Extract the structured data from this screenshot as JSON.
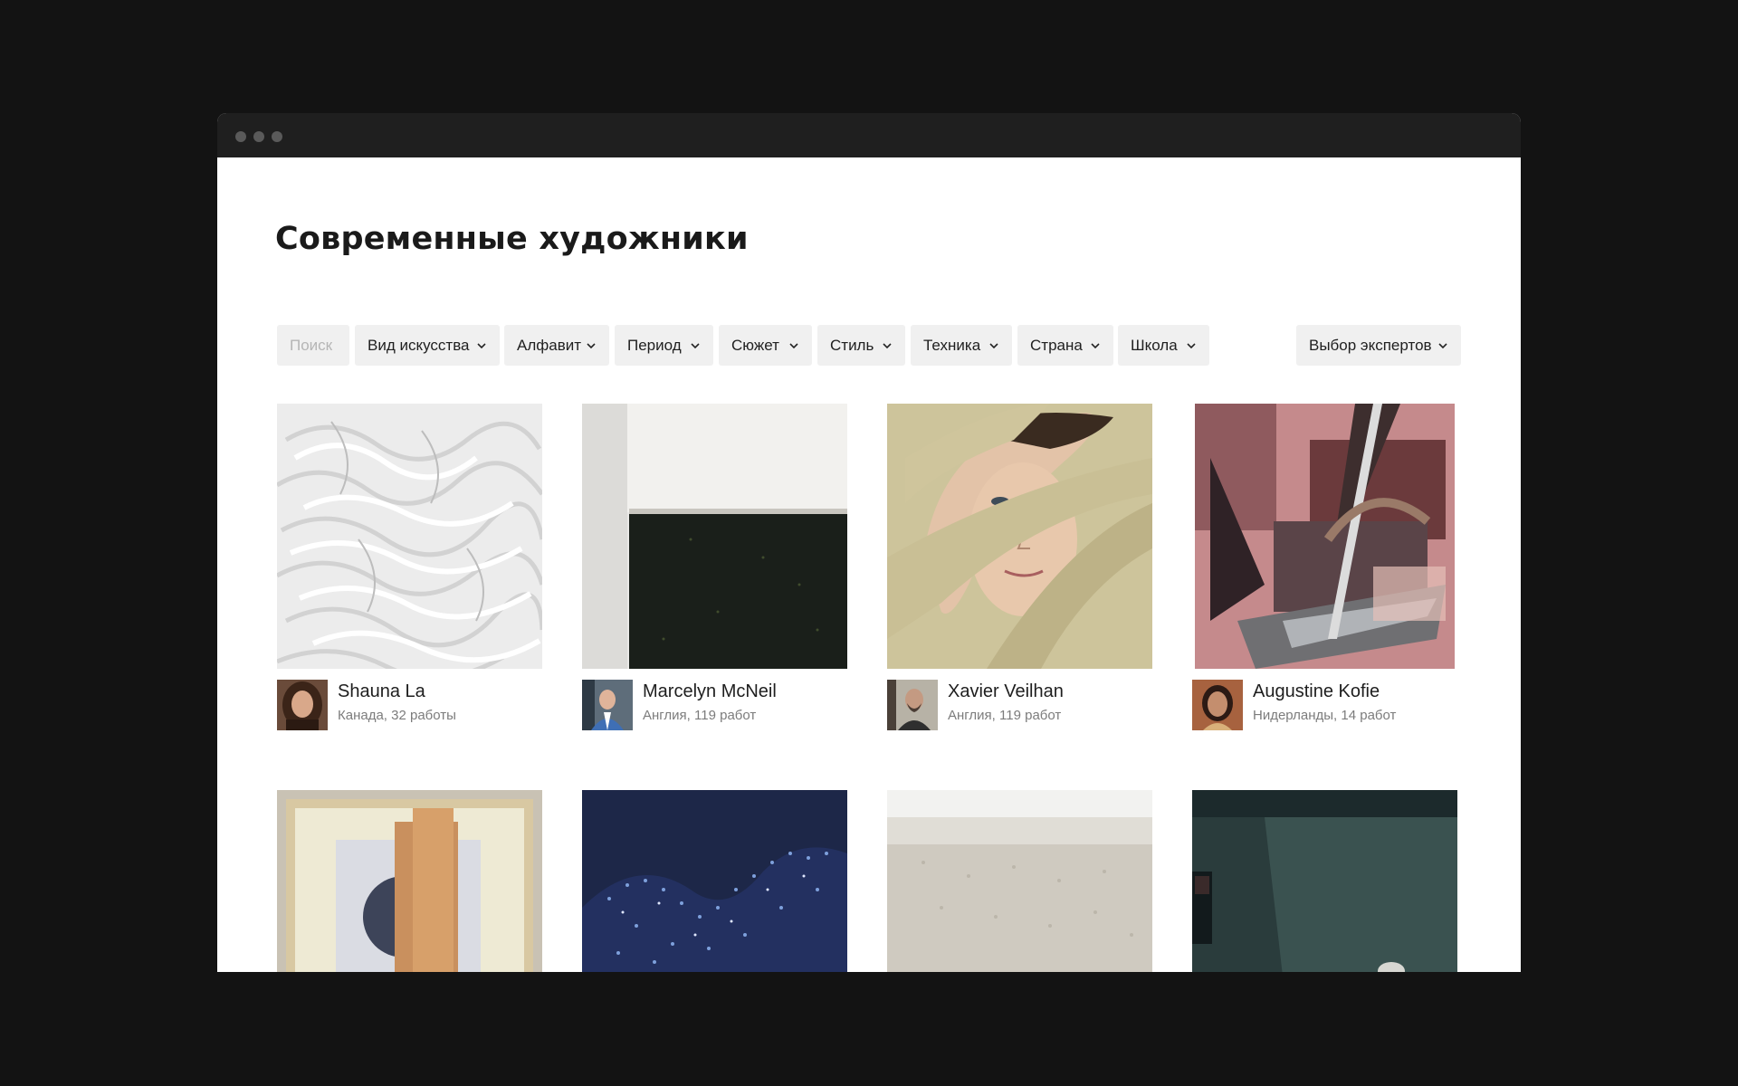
{
  "page": {
    "title": "Современные художники"
  },
  "filters": {
    "search_placeholder": "Поиск",
    "items": [
      {
        "label": "Вид искусства"
      },
      {
        "label": "Алфавит"
      },
      {
        "label": "Период"
      },
      {
        "label": "Сюжет"
      },
      {
        "label": "Стиль"
      },
      {
        "label": "Техника"
      },
      {
        "label": "Страна"
      },
      {
        "label": "Школа"
      }
    ],
    "experts": "Выбор экспертов"
  },
  "artists": [
    {
      "name": "Shauna La",
      "details": "Канада, 32 работы"
    },
    {
      "name": "Marcelyn McNeil",
      "details": "Англия, 119 работ"
    },
    {
      "name": "Xavier Veilhan",
      "details": "Англия, 119 работ"
    },
    {
      "name": "Augustine Kofie",
      "details": "Нидерланды, 14 работ"
    }
  ],
  "colors": {
    "background": "#131313",
    "titlebar": "#1f1f1f",
    "chip": "#f0f0f0",
    "text": "#1e1e1e",
    "muted": "#7c7c7c"
  },
  "icons": {
    "dropdown": "chevron-down-icon",
    "window_controls": "window-dot-icon"
  }
}
